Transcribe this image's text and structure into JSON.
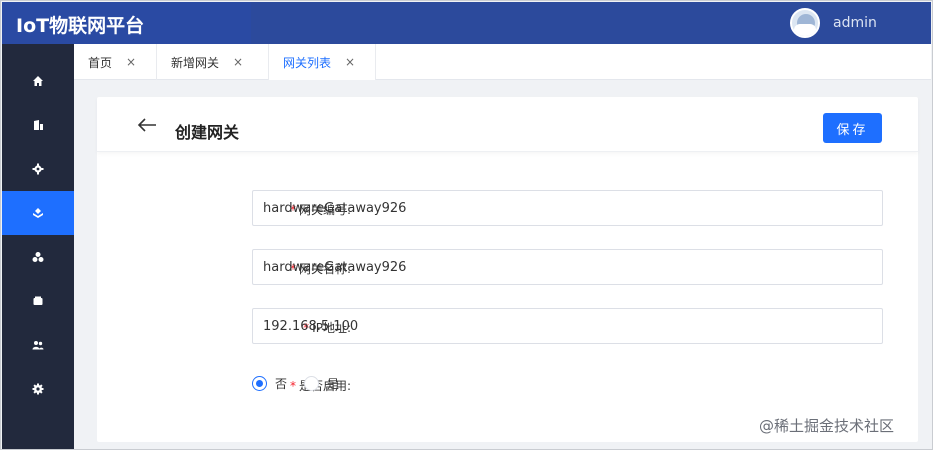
{
  "header": {
    "app_title": "IoT物联网平台",
    "username": "admin"
  },
  "sidebar": {
    "items": [
      {
        "icon": "home-icon",
        "active": false
      },
      {
        "icon": "building-icon",
        "active": false
      },
      {
        "icon": "gear-icon",
        "active": false
      },
      {
        "icon": "gateway-icon",
        "active": true
      },
      {
        "icon": "cluster-icon",
        "active": false
      },
      {
        "icon": "device-icon",
        "active": false
      },
      {
        "icon": "users-icon",
        "active": false
      },
      {
        "icon": "settings-icon",
        "active": false
      }
    ]
  },
  "tabs": [
    {
      "label": "首页",
      "close": "×",
      "active": false
    },
    {
      "label": "新增网关",
      "close": "×",
      "active": false
    },
    {
      "label": "网关列表",
      "close": "×",
      "active": true
    }
  ],
  "page": {
    "title": "创建网关",
    "save_label": "保存"
  },
  "form": {
    "required_mark": "*",
    "gateway_id_label": "网关编号:",
    "gateway_id_value": "hardwareGataway926",
    "gateway_name_label": "网关名称:",
    "gateway_name_value": "hardwareGataway926",
    "ip_label": "IP地址:",
    "ip_value": "192.168.5.100",
    "enabled_label": "是否启用:",
    "enabled_options": [
      {
        "label": "否",
        "selected": true
      },
      {
        "label": "是",
        "selected": false
      }
    ]
  },
  "watermark": "@稀土掘金技术社区",
  "colors": {
    "accent": "#1e6fff",
    "header": "#2c4a9c",
    "sidebar": "#22293d",
    "required": "#f5222d"
  }
}
